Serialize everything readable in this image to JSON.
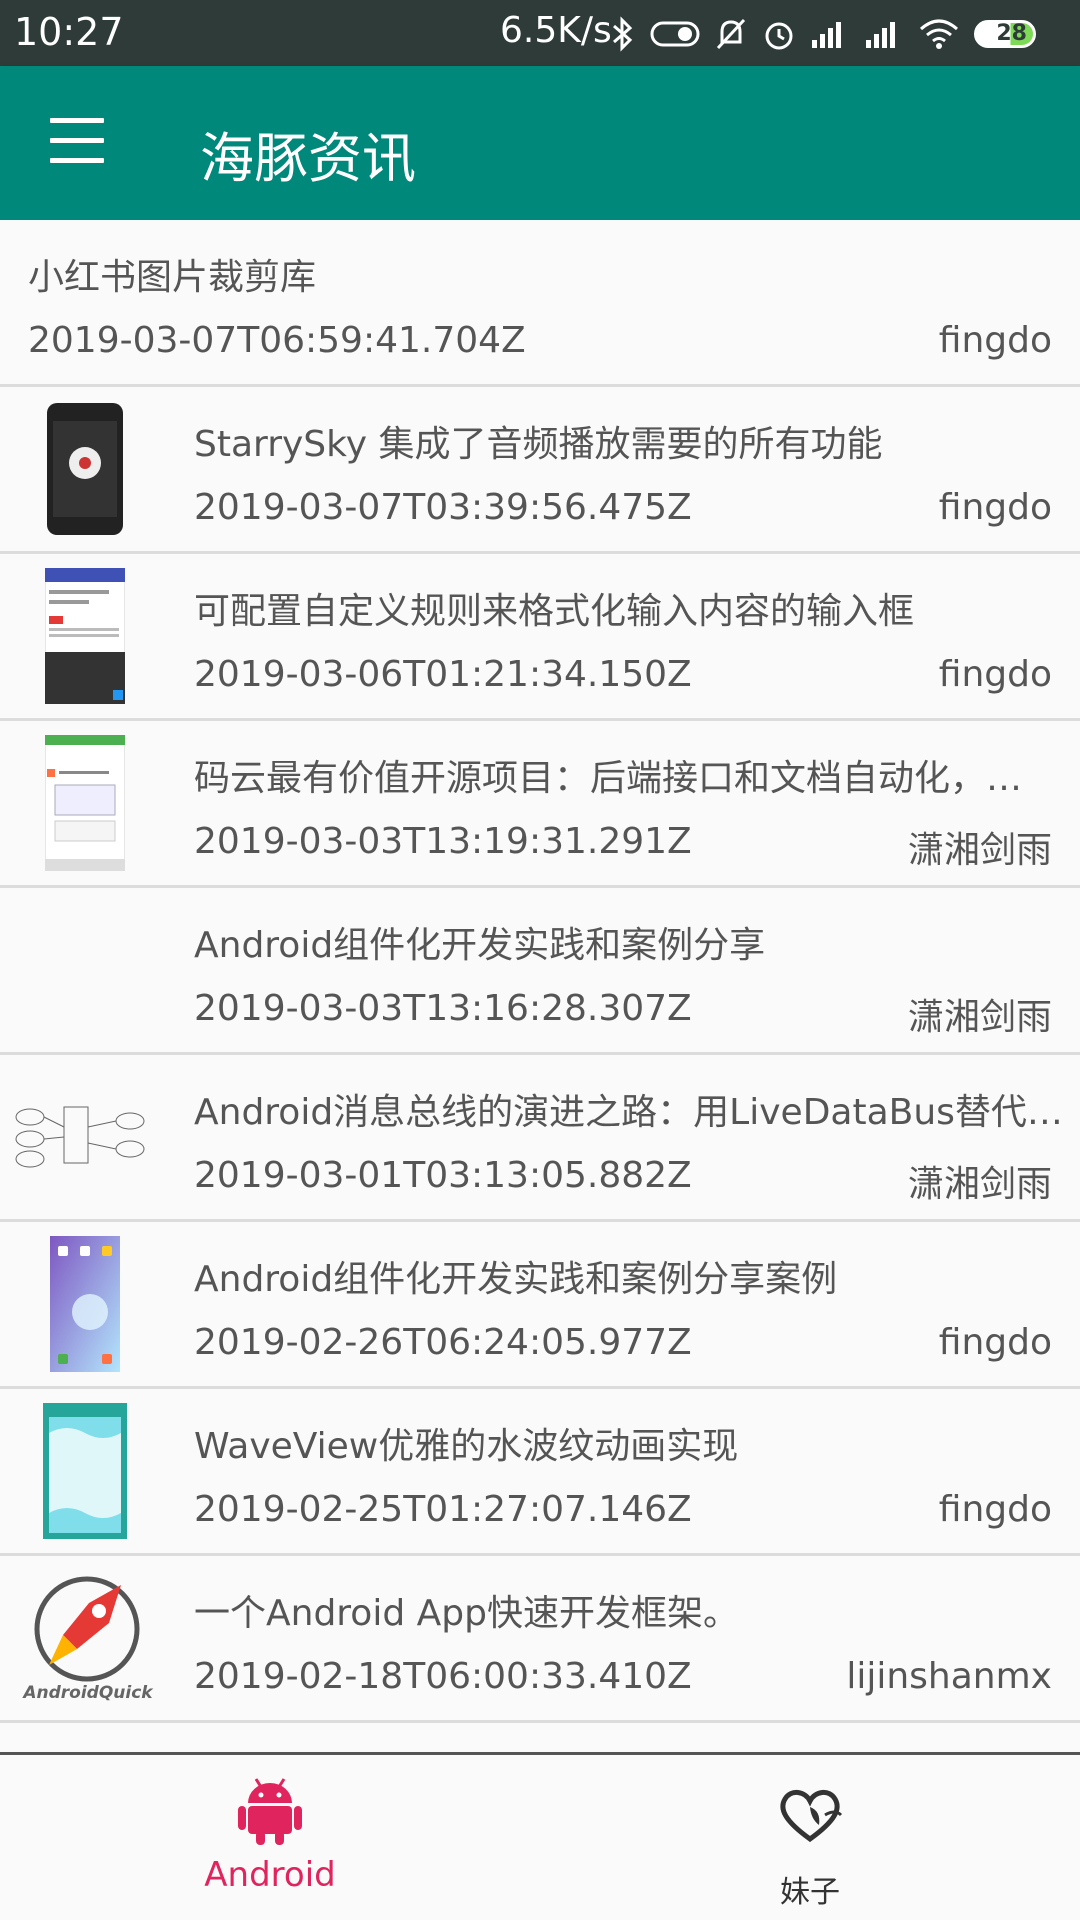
{
  "status_bar": {
    "time": "10:27",
    "net_speed": "6.5K/s",
    "battery": "28",
    "icons": [
      "bluetooth-icon",
      "toggle-icon",
      "mute-icon",
      "alarm-icon",
      "signal-icon",
      "signal-icon",
      "wifi-icon",
      "battery-icon"
    ]
  },
  "app_bar": {
    "title": "海豚资讯",
    "menu_icon": "hamburger-menu-icon",
    "color": "#00897b"
  },
  "articles": [
    {
      "title": "小红书图片裁剪库",
      "date": "2019-03-07T06:59:41.704Z",
      "author": "fingdo",
      "thumb": "none"
    },
    {
      "title": "StarrySky 集成了音频播放需要的所有功能",
      "date": "2019-03-07T03:39:56.475Z",
      "author": "fingdo",
      "thumb": "phone-screenshot"
    },
    {
      "title": " 可配置自定义规则来格式化输入内容的输入框",
      "date": "2019-03-06T01:21:34.150Z",
      "author": "fingdo",
      "thumb": "keyboard-screenshot"
    },
    {
      "title": "码云最有价值开源项目：后端接口和文档自动化，…",
      "date": "2019-03-03T13:19:31.291Z",
      "author": "潇湘剑雨",
      "thumb": "doc-screenshot"
    },
    {
      "title": "Android组件化开发实践和案例分享",
      "date": "2019-03-03T13:16:28.307Z",
      "author": "潇湘剑雨",
      "thumb": "none"
    },
    {
      "title": "Android消息总线的演进之路：用LiveDataBus替代…",
      "date": "2019-03-01T03:13:05.882Z",
      "author": "潇湘剑雨",
      "thumb": "diagram"
    },
    {
      "title": "Android组件化开发实践和案例分享案例",
      "date": "2019-02-26T06:24:05.977Z",
      "author": "fingdo",
      "thumb": "home-screenshot"
    },
    {
      "title": "WaveView优雅的水波纹动画实现",
      "date": "2019-02-25T01:27:07.146Z",
      "author": "fingdo",
      "thumb": "wave-screenshot"
    },
    {
      "title": "一个Android App快速开发框架。",
      "date": "2019-02-18T06:00:33.410Z",
      "author": "lijinshanmx",
      "thumb": "rocket-logo",
      "thumb_text": "AndroidQuick"
    }
  ],
  "bottom_nav": {
    "tabs": [
      {
        "label": "Android",
        "icon": "android-icon",
        "active": true,
        "color": "#e0245e"
      },
      {
        "label": "妹子",
        "icon": "heart-icon",
        "active": false
      }
    ]
  }
}
